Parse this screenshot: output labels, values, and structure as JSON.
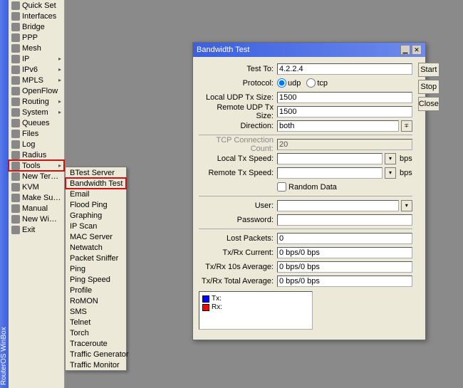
{
  "app": {
    "vertical_title": "RouterOS WinBox"
  },
  "sidebar": {
    "items": [
      {
        "label": "Quick Set",
        "icon": "ic-quickset",
        "submenu": false
      },
      {
        "label": "Interfaces",
        "icon": "ic-interfaces",
        "submenu": false
      },
      {
        "label": "Bridge",
        "icon": "ic-bridge",
        "submenu": false
      },
      {
        "label": "PPP",
        "icon": "ic-ppp",
        "submenu": false
      },
      {
        "label": "Mesh",
        "icon": "ic-mesh",
        "submenu": false
      },
      {
        "label": "IP",
        "icon": "ic-ip",
        "submenu": true
      },
      {
        "label": "IPv6",
        "icon": "ic-ipv6",
        "submenu": true
      },
      {
        "label": "MPLS",
        "icon": "ic-mpls",
        "submenu": true
      },
      {
        "label": "OpenFlow",
        "icon": "ic-openflow",
        "submenu": false
      },
      {
        "label": "Routing",
        "icon": "ic-routing",
        "submenu": true
      },
      {
        "label": "System",
        "icon": "ic-system",
        "submenu": true
      },
      {
        "label": "Queues",
        "icon": "ic-queues",
        "submenu": false
      },
      {
        "label": "Files",
        "icon": "ic-files",
        "submenu": false
      },
      {
        "label": "Log",
        "icon": "ic-log",
        "submenu": false
      },
      {
        "label": "Radius",
        "icon": "ic-radius",
        "submenu": false
      },
      {
        "label": "Tools",
        "icon": "ic-tools",
        "submenu": true,
        "highlighted": true
      },
      {
        "label": "New Terminal",
        "icon": "ic-newterm",
        "submenu": false
      },
      {
        "label": "KVM",
        "icon": "ic-kvm",
        "submenu": false
      },
      {
        "label": "Make Supout.rif",
        "icon": "ic-supout",
        "submenu": false
      },
      {
        "label": "Manual",
        "icon": "ic-manual",
        "submenu": false
      },
      {
        "label": "New WinBox",
        "icon": "ic-winbox",
        "submenu": false
      },
      {
        "label": "Exit",
        "icon": "ic-exit",
        "submenu": false
      }
    ]
  },
  "submenu": {
    "items": [
      {
        "label": "BTest Server"
      },
      {
        "label": "Bandwidth Test",
        "highlighted": true
      },
      {
        "label": "Email"
      },
      {
        "label": "Flood Ping"
      },
      {
        "label": "Graphing"
      },
      {
        "label": "IP Scan"
      },
      {
        "label": "MAC Server"
      },
      {
        "label": "Netwatch"
      },
      {
        "label": "Packet Sniffer"
      },
      {
        "label": "Ping"
      },
      {
        "label": "Ping Speed"
      },
      {
        "label": "Profile"
      },
      {
        "label": "RoMON"
      },
      {
        "label": "SMS"
      },
      {
        "label": "Telnet"
      },
      {
        "label": "Torch"
      },
      {
        "label": "Traceroute"
      },
      {
        "label": "Traffic Generator"
      },
      {
        "label": "Traffic Monitor"
      }
    ]
  },
  "dialog": {
    "title": "Bandwidth Test",
    "buttons": {
      "start": "Start",
      "stop": "Stop",
      "close": "Close"
    },
    "fields": {
      "test_to": {
        "label": "Test To:",
        "value": "4.2.2.4"
      },
      "protocol": {
        "label": "Protocol:",
        "udp": "udp",
        "tcp": "tcp",
        "selected": "udp"
      },
      "local_udp_tx": {
        "label": "Local UDP Tx Size:",
        "value": "1500"
      },
      "remote_udp_tx": {
        "label": "Remote UDP Tx Size:",
        "value": "1500"
      },
      "direction": {
        "label": "Direction:",
        "value": "both"
      },
      "tcp_conn": {
        "label": "TCP Connection Count:",
        "value": "20",
        "disabled": true
      },
      "local_tx_speed": {
        "label": "Local Tx Speed:",
        "unit": "bps"
      },
      "remote_tx_speed": {
        "label": "Remote Tx Speed:",
        "unit": "bps"
      },
      "random_data": {
        "label": "Random Data",
        "checked": false
      },
      "user": {
        "label": "User:",
        "value": ""
      },
      "password": {
        "label": "Password:",
        "value": ""
      },
      "lost_packets": {
        "label": "Lost Packets:",
        "value": "0"
      },
      "txrx_current": {
        "label": "Tx/Rx Current:",
        "value": "0 bps/0 bps"
      },
      "txrx_avg10": {
        "label": "Tx/Rx 10s Average:",
        "value": "0 bps/0 bps"
      },
      "txrx_total": {
        "label": "Tx/Rx Total Average:",
        "value": "0 bps/0 bps"
      }
    },
    "chart": {
      "tx_label": "Tx:",
      "rx_label": "Rx:",
      "tx_color": "#0000ff",
      "rx_color": "#ff0000"
    }
  }
}
